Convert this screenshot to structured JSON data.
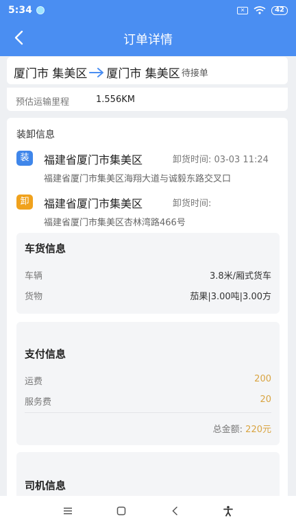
{
  "status_bar": {
    "time": "5:34",
    "battery": "42"
  },
  "header": {
    "title": "订单详情"
  },
  "route": {
    "from": "厦门市 集美区",
    "to": "厦门市 集美区",
    "status": "待接单"
  },
  "mileage": {
    "label": "预估运输里程",
    "value": "1.556KM"
  },
  "loading": {
    "section_title": "装卸信息",
    "load": {
      "badge": "装",
      "city": "福建省厦门市集美区",
      "time_label": "卸货时间: 03-03 11:24",
      "address": "福建省厦门市集美区海翔大道与诚毅东路交叉口"
    },
    "unload": {
      "badge": "卸",
      "city": "福建省厦门市集美区",
      "time_label": "卸货时间:",
      "address": "福建省厦门市集美区杏林湾路466号"
    }
  },
  "cargo": {
    "title": "车货信息",
    "vehicle_label": "车辆",
    "vehicle_value": "3.8米/厢式货车",
    "goods_label": "货物",
    "goods_value": "茄果|3.00吨|3.00方"
  },
  "payment": {
    "title": "支付信息",
    "freight_label": "运费",
    "freight_value": "200",
    "service_label": "服务费",
    "service_value": "20",
    "total_label": "总金额:",
    "total_value": "220元"
  },
  "driver": {
    "title": "司机信息"
  },
  "colors": {
    "primary": "#4a8ef2",
    "load_badge": "#3f86ea",
    "unload_badge": "#f0a21d",
    "amount": "#d9a441"
  },
  "icons": {
    "back": "chevron-left-icon",
    "menu": "menu-icon",
    "home": "square-icon",
    "nav_back": "nav-back-icon",
    "accessibility": "accessibility-icon"
  }
}
